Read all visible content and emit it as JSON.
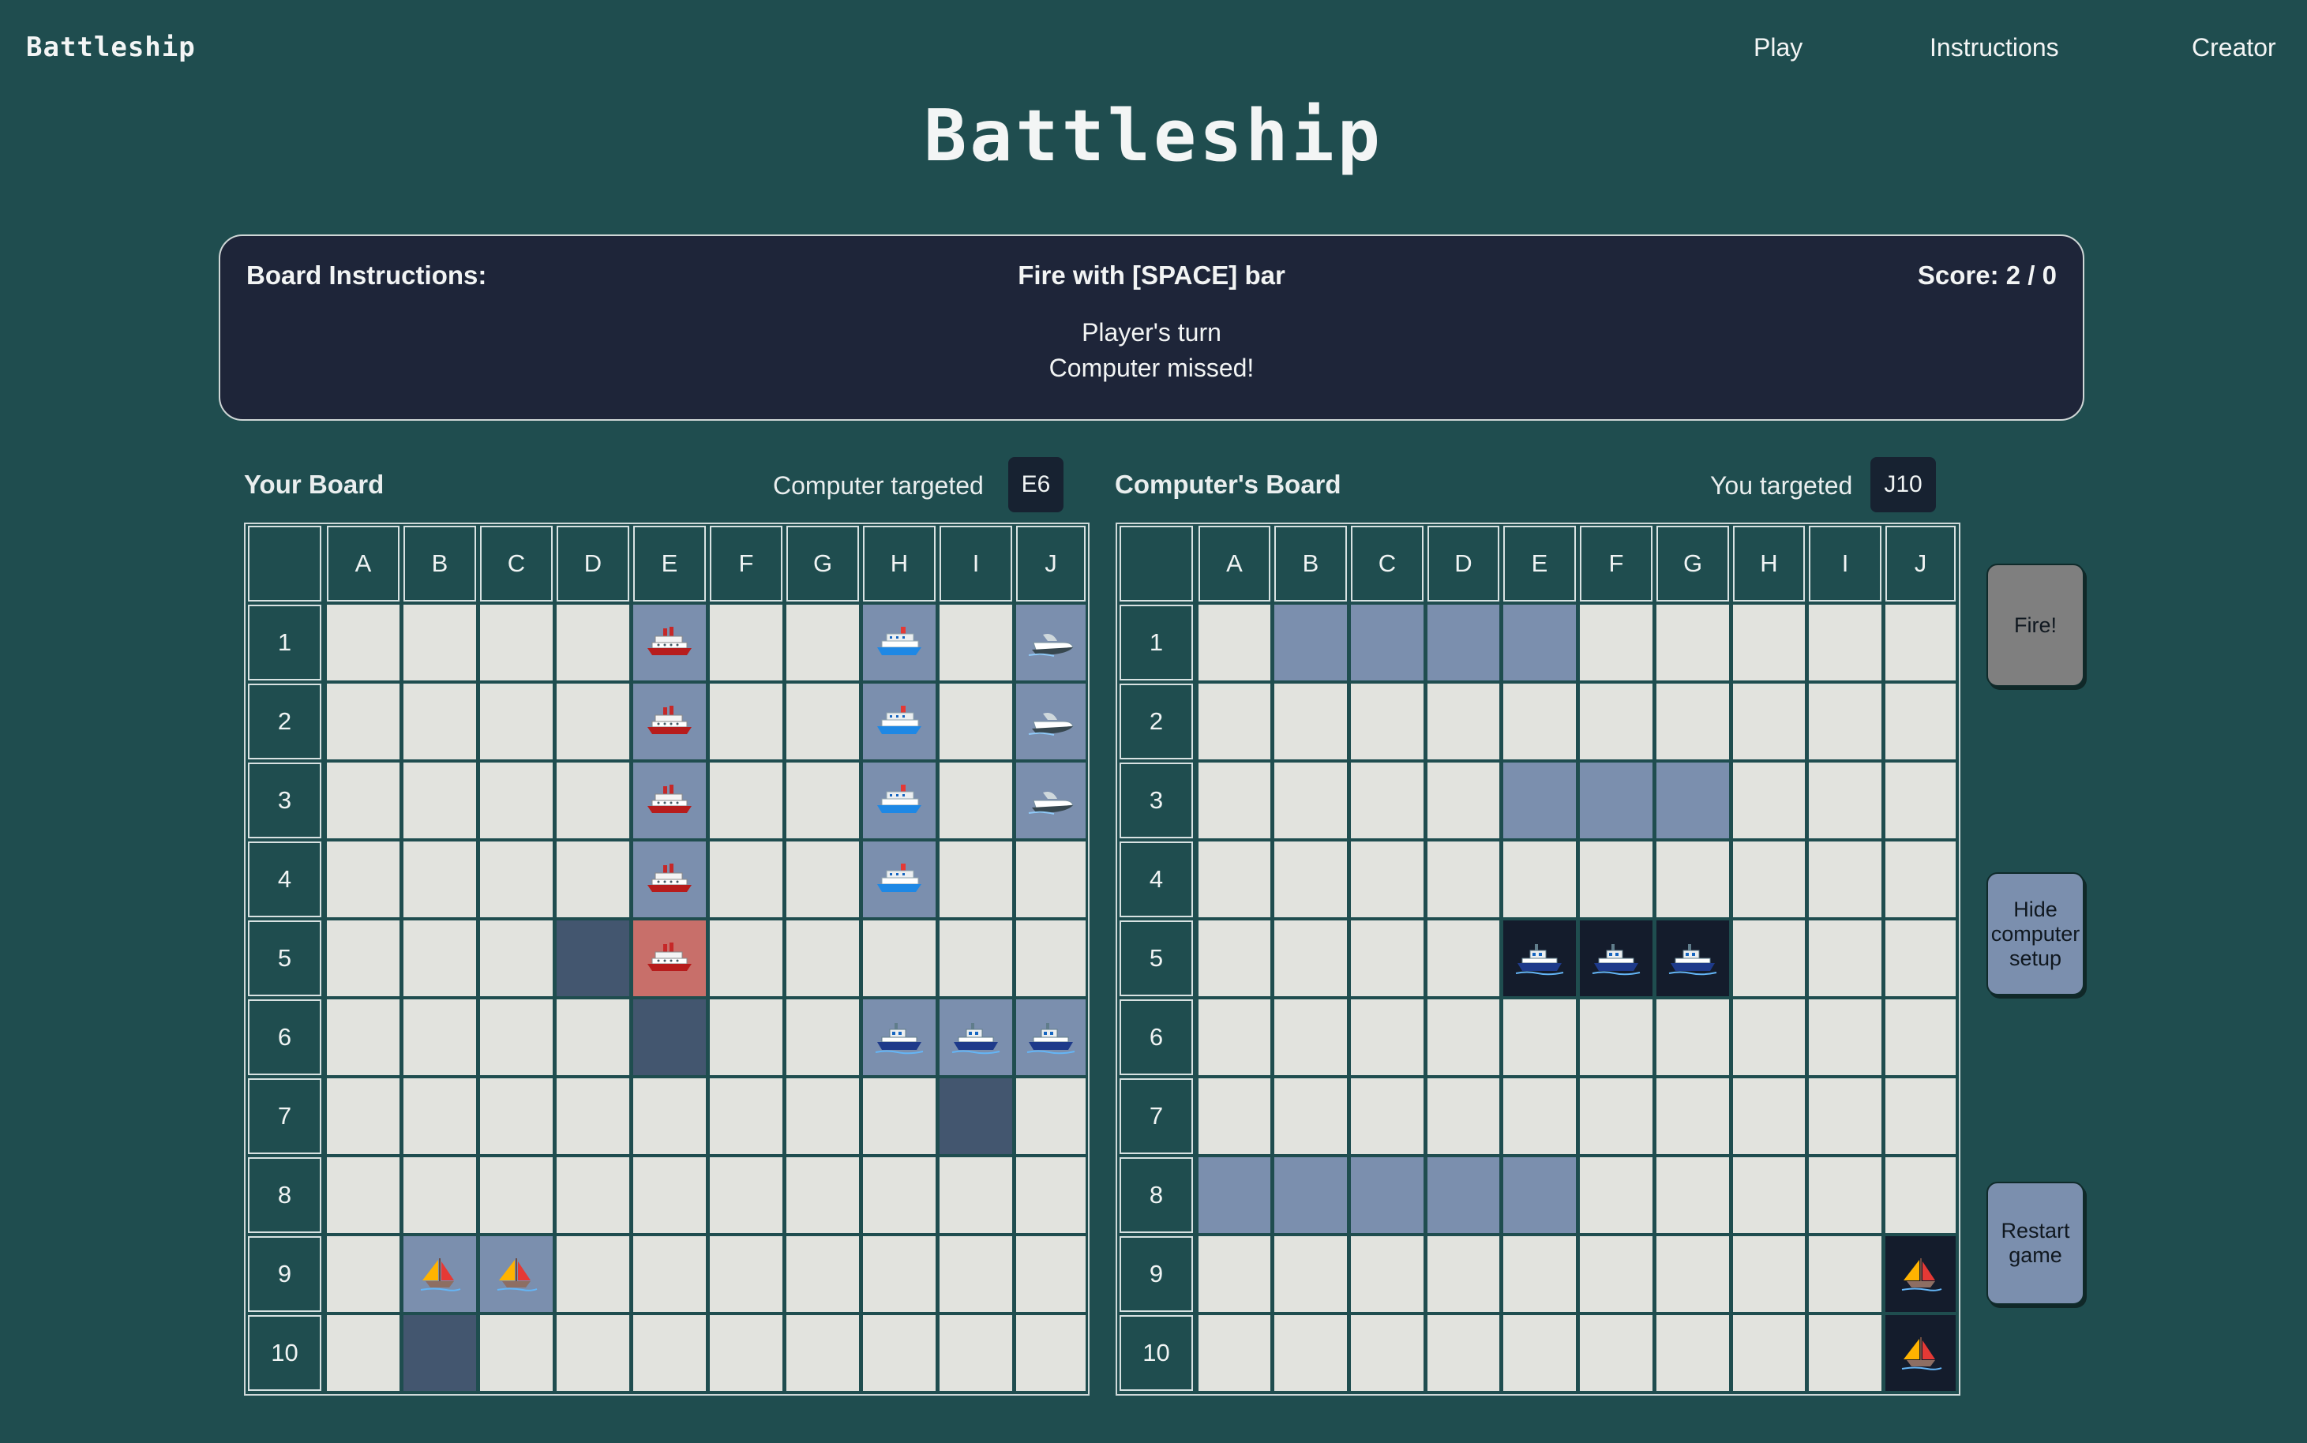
{
  "nav": {
    "logo": "Battleship",
    "links": [
      "Play",
      "Instructions",
      "Creator"
    ]
  },
  "page_title": "Battleship",
  "panel": {
    "left_heading": "Board Instructions:",
    "center_heading": "Fire with [SPACE] bar",
    "score": "Score: 2 / 0",
    "status_lines": [
      "Player's turn",
      "Computer missed!"
    ]
  },
  "player_board": {
    "title": "Your Board",
    "target_label": "Computer targeted",
    "target_value": "E6"
  },
  "computer_board": {
    "title": "Computer's Board",
    "target_label": "You targeted",
    "target_value": "J10"
  },
  "columns": [
    "A",
    "B",
    "C",
    "D",
    "E",
    "F",
    "G",
    "H",
    "I",
    "J"
  ],
  "rows": [
    "1",
    "2",
    "3",
    "4",
    "5",
    "6",
    "7",
    "8",
    "9",
    "10"
  ],
  "legend": {
    "S": "ship",
    "X": "hit",
    "M": "miss",
    "R": "revealed ship",
    ".": "empty"
  },
  "player_grid": [
    "....S..S.S",
    "....S..S.S",
    "....S..S.S",
    "....S..S..",
    "...MX.....",
    "....M..SSS",
    "........M.",
    "..........",
    ".SS.......",
    ".M........"
  ],
  "player_icons": [
    "....a..b.c",
    "....a..b.c",
    "....a..b.c",
    "....a..b..",
    "....a.....",
    ".......ddd",
    "..........",
    "..........",
    ".ee.......",
    ".........."
  ],
  "computer_grid": [
    ".SSSS.....",
    "..........",
    "....SSS...",
    "..........",
    "....RRR...",
    "..........",
    "..........",
    "SSSSS.....",
    ".........R",
    ".........R"
  ],
  "computer_icons": [
    "..........",
    "..........",
    "..........",
    "..........",
    "....ddd...",
    "..........",
    "..........",
    "..........",
    ".........e",
    ".........e"
  ],
  "icon_names": {
    "a": "cruise-ship-icon",
    "b": "passenger-ship-icon",
    "c": "speedboat-icon",
    "d": "motor-boat-icon",
    "e": "sailboat-icon"
  },
  "buttons": {
    "fire": "Fire!",
    "hide": "Hide computer setup",
    "restart": "Restart game"
  },
  "colors": {
    "background": "#1f4d4f",
    "panel": "#1e2539",
    "empty_cell": "#e2e3de",
    "ship_cell": "#7b8fae",
    "hit_cell": "#c86f6a",
    "miss_cell": "#43566f",
    "revealed_cell": "#141c2c",
    "fire_button": "#7f7f7f",
    "action_button": "#7b8fae"
  }
}
